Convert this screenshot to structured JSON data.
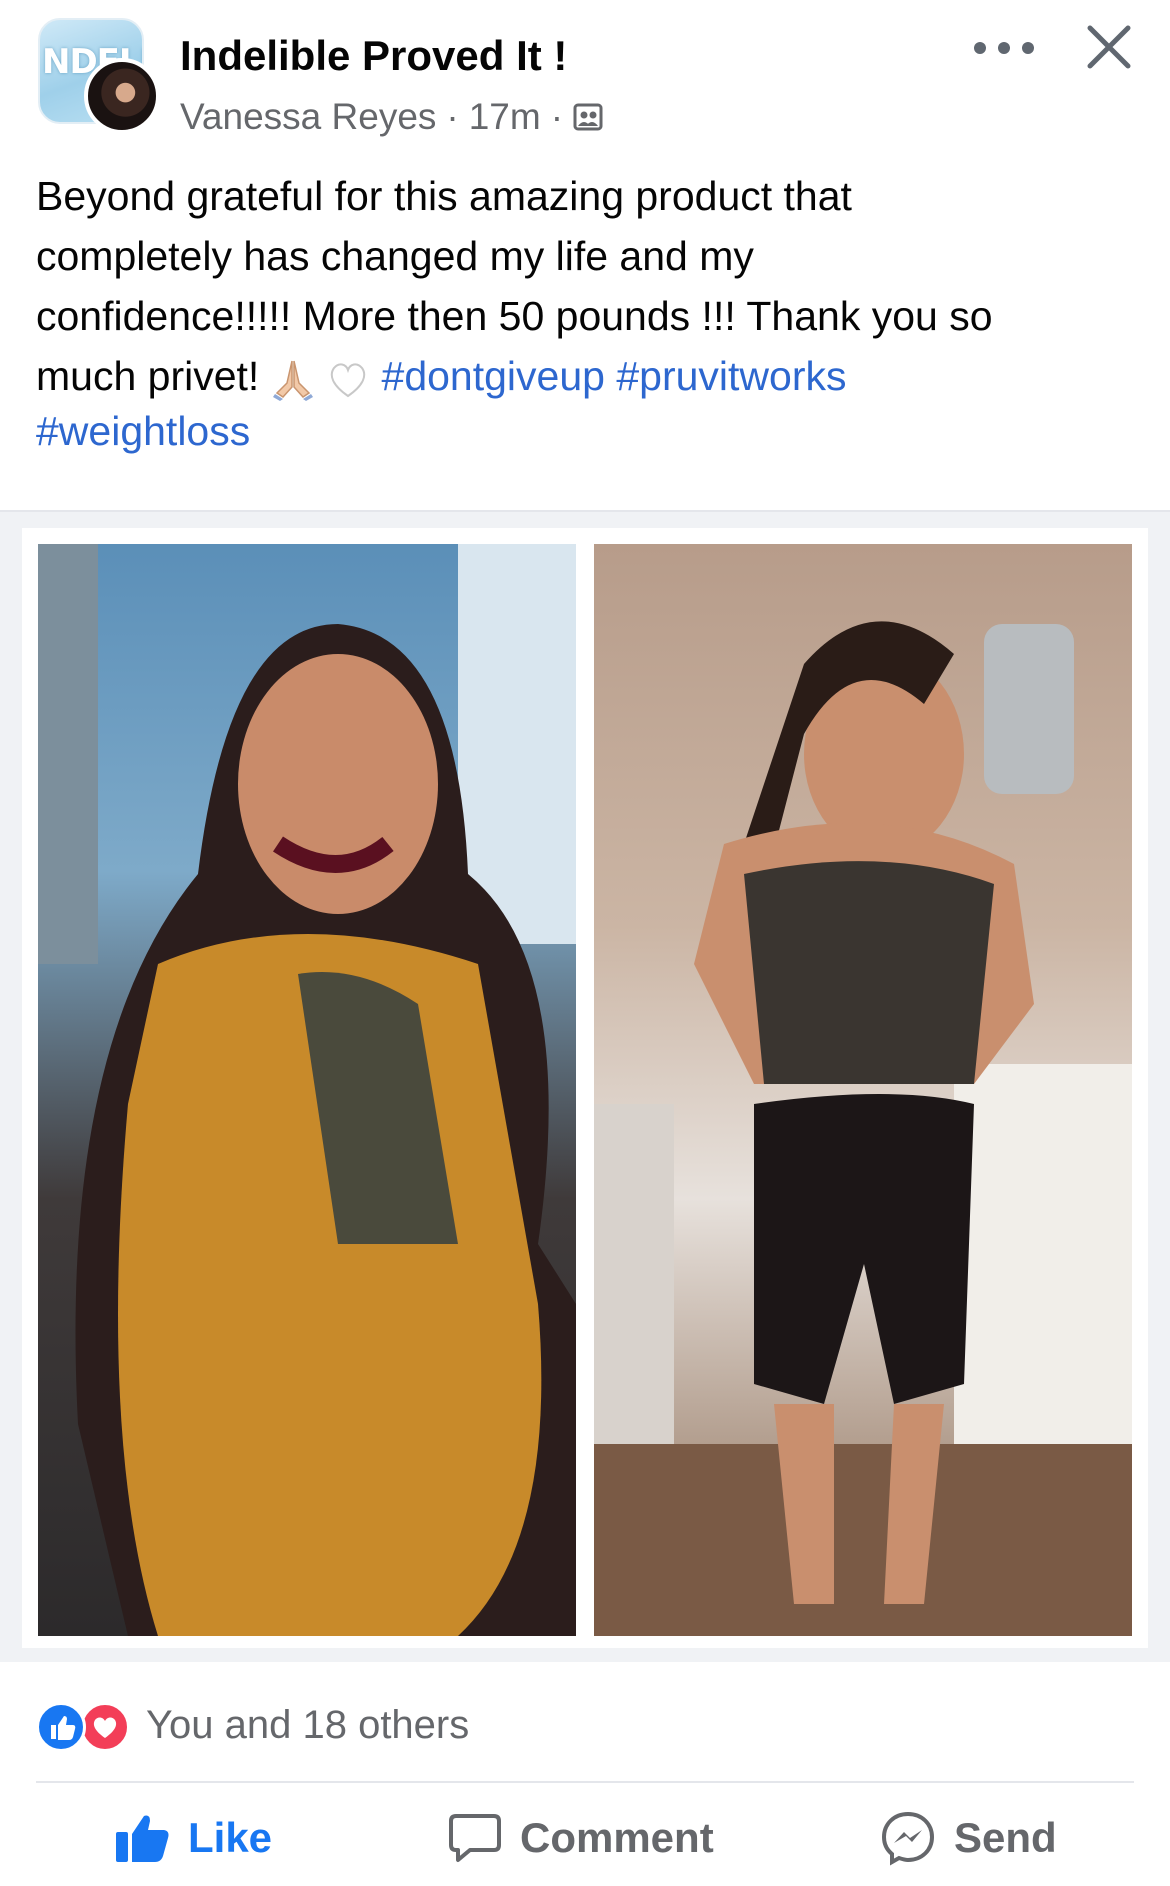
{
  "header": {
    "group_name": "Indelible Proved It !",
    "group_logo_text": "NDELIB",
    "author": "Vanessa Reyes",
    "separator": "·",
    "time": "17m"
  },
  "post": {
    "line1": "Beyond grateful for this amazing product that",
    "line2": "completely has changed my life and my",
    "line3": "confidence!!!!! More then 50 pounds !!! Thank you so",
    "line4_text": "much privet! ",
    "hashtags": [
      "#dontgiveup",
      "#pruvitworks",
      "#weightloss"
    ]
  },
  "reactions": {
    "text": "You and 18 others",
    "types": [
      "like-icon",
      "love-icon"
    ]
  },
  "actions": {
    "like": "Like",
    "comment": "Comment",
    "send": "Send"
  },
  "colors": {
    "link": "#2d67cf",
    "like_blue": "#1877f2",
    "love_red": "#f33e58",
    "meta_gray": "#65676b"
  }
}
